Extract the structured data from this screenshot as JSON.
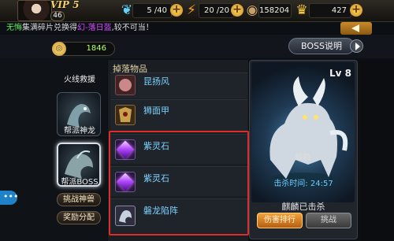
{
  "header": {
    "vip": "VIP 5",
    "level": "46",
    "stamina": "5 /40",
    "energy": "20 /20",
    "silver": "158204",
    "gold": "427"
  },
  "ticker": {
    "player": "无悔",
    "text_before": "集满碎片兑换得",
    "item": "幻-落日盔",
    "text_after": ",较不可当！"
  },
  "coins": "1846",
  "boss_info_button": "BOSS说明",
  "menu": {
    "item1_label": "火线救援",
    "item2_label": "帮派神龙",
    "item3_label": "帮派BOSS",
    "challenge_beast": "挑战神兽",
    "reward_dist": "奖励分配"
  },
  "drops": {
    "title": "掉落物品",
    "items": [
      {
        "name": "昆扬风"
      },
      {
        "name": "狮面甲"
      },
      {
        "name": "紫灵石"
      },
      {
        "name": "紫灵石"
      },
      {
        "name": "磐龙陷阵"
      }
    ]
  },
  "boss": {
    "level": "Lv 8",
    "name": "麒麟",
    "kill_time": "击杀时间: 24:57",
    "status": "麒麟已击杀",
    "rank_button": "伤害排行",
    "challenge_button": "挑战"
  },
  "icons": {
    "stamina": "feather-icon",
    "energy": "lightning-icon",
    "silver": "coin-icon",
    "gold": "gold-ingot-icon"
  }
}
